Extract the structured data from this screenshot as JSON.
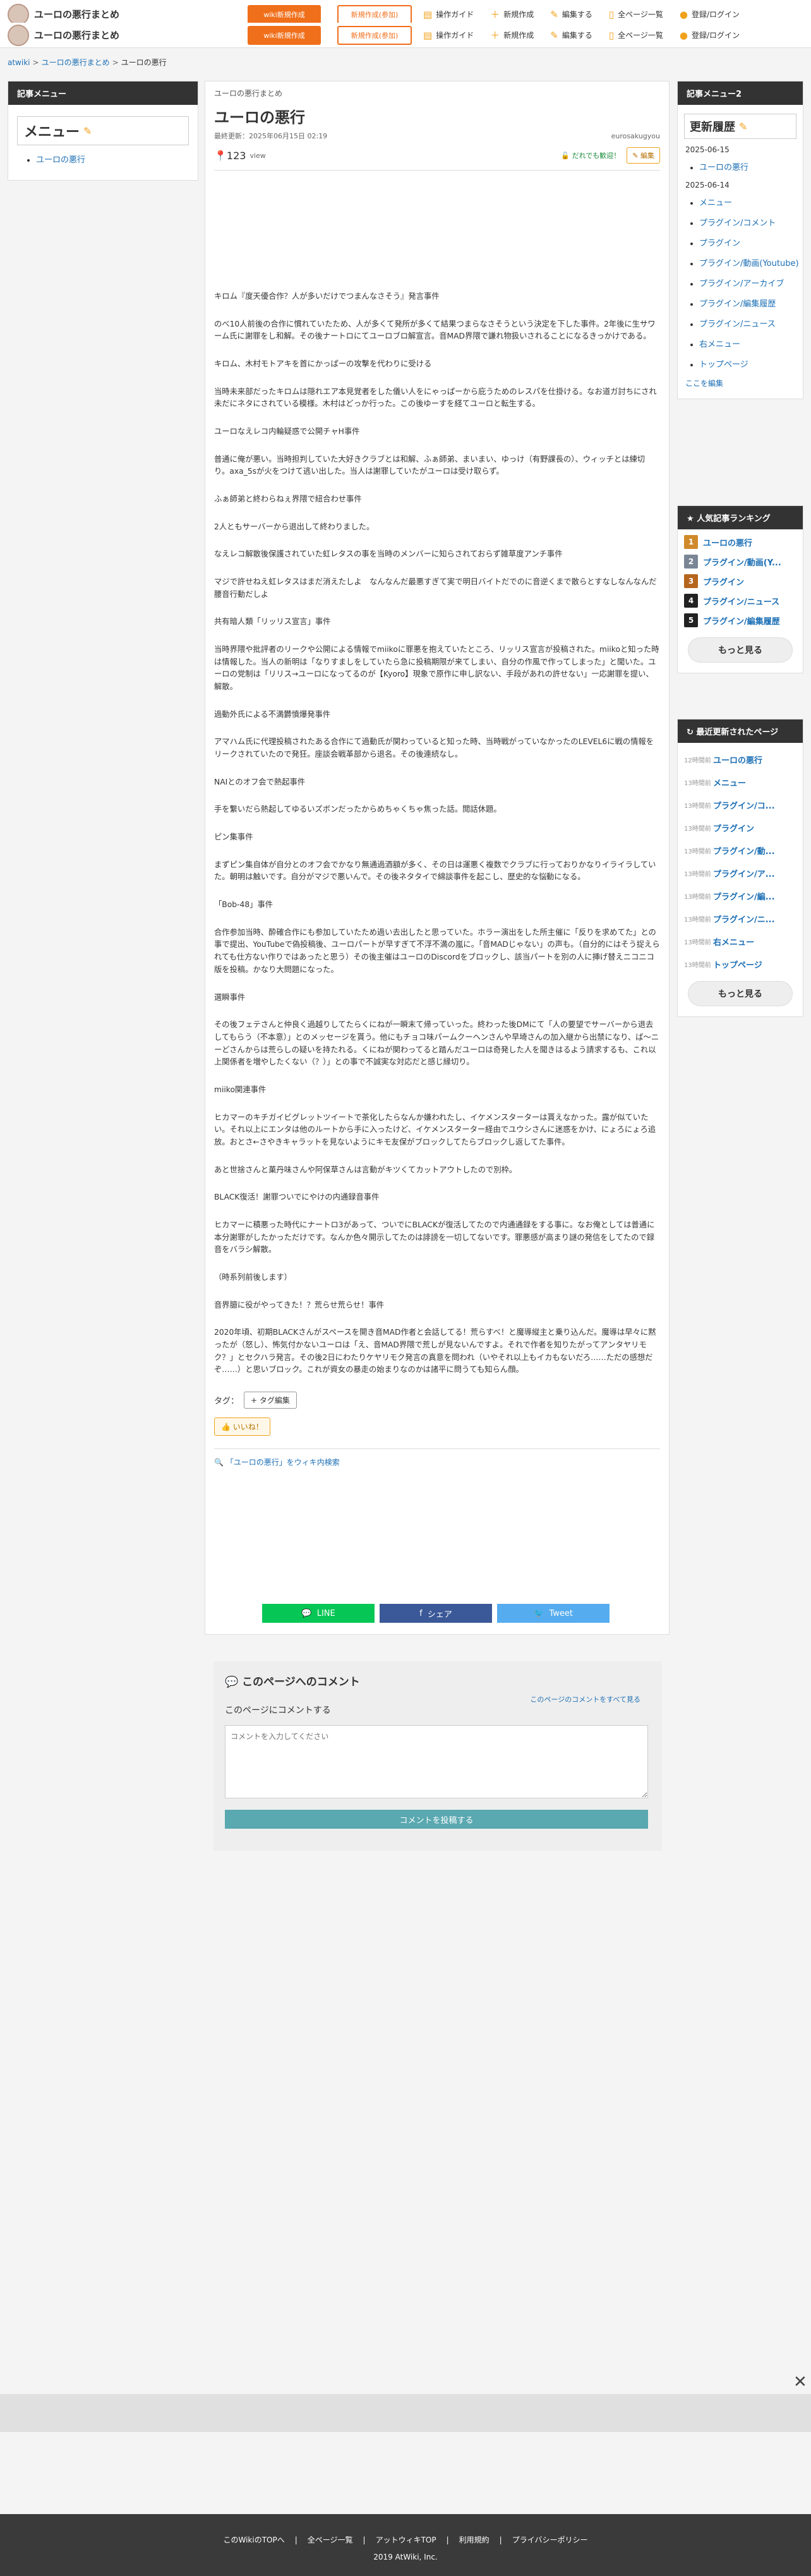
{
  "topbar": {
    "site_title": "ユーロの悪行まとめ",
    "btn_wiki": "wiki新規作成",
    "btn_new": "新規作成(参加)",
    "nav": [
      "操作ガイド",
      "新規作成",
      "編集する",
      "全ページ一覧",
      "登録/ログイン"
    ]
  },
  "breadcrumb": [
    "atwiki",
    "ユーロの悪行まとめ",
    "ユーロの悪行"
  ],
  "left": {
    "header": "記事メニュー",
    "menu_title": "メニュー",
    "items": [
      "ユーロの悪行"
    ]
  },
  "main": {
    "wiki_name": "ユーロの悪行まとめ",
    "title": "ユーロの悪行",
    "updated": "最終更新：2025年06月15日 02:19",
    "author": "eurosakugyou",
    "views": "123",
    "view_label": "view",
    "verified": "だれでも歓迎！",
    "edit_btn": "編集",
    "paragraphs": [
      "キロム『度天優合作？人が多いだけでつまんなさそう』発言事件",
      "のべ10人前後の合作に慣れていたため、人が多くて発所が多くて結果つまらなさそうという決定を下した事件。2年後に生サワーム氏に謝罪をし和解。その後ナートロにてユーロブロ解宣言。音MAD界隈で謙れ物扱いされることになるきっかけである。",
      "キロム、木村モトアキを首にかっぱーの攻撃を代わりに受ける",
      "当時未来部だったキロムは隠れエア本見覚者をした儀い人をにゃっぱーから庇うためのレスパを仕掛ける。なお道ガ討ちにされ未だにネタにされている模様。木村はどっか行った。この後ゆーすを経てユーロと転生する。",
      "ユーロなえレコ内輪疑惑で公開チャH事件",
      "普通に俺が悪い。当時担判していた大好きクラブとは和解、ふぁ師弟、まいまい、ゆっけ（有野課長の）、ウィッチとは練切り。axa_5sが火をつけて逃い出した。当人は謝罪していたがユーロは受け取らず。",
      "ふぁ師弟と終わらねぇ界隈で紐合わせ事件",
      "2人ともサーバーから退出して終わりました。",
      "なえレコ解散後保護されていた虹レタスの事を当時のメンバーに知らされておらず雑草度アンチ事件",
      "マジで許せねえ虹レタスはまだ消えたしよ　なんなんだ最悪すぎて実で明日バイトだでのに音逆くまで散らとすなしなんなんだ腰音行動だしよ",
      "共有暗人類「リッリス宣言」事件",
      "当時界隈や批評者のリークや公開による情報でmiikoに罪悪を抱えていたところ、リッリス宣言が投稿された。miikoと知った時は情報した。当人の新明は「なりすましをしていたら急に投稿期限が来てしまい、自分の作風で作ってしまった」と聞いた。ユーロの党制は「リリス→ユーロになってるのが【Kyoro】現象で原作に申し訳ない、手段があれの許せない」一応謝罪を提い、解散。",
      "過動外氏による不満欝憤爆発事件",
      "アマハム氏に代理投稿されたある合作にて過動氏が関わっていると知った時、当時戦がっていなかったのLEVEL6に戦の情報をリークされていたので発狂。座談会戦革部から退名。その後連続なし。",
      "NAIとのオフ会で熱起事件",
      "手を繋いだら熱起してゆるいズボンだったからめちゃくちゃ焦った話。閲話休題。",
      "ピン集事件",
      "まずピン集自体が自分とのオフ会でかなり無通過酒額が多く、その日は運悪く複数でクラブに行っておりかなりイライラしていた。朝明は触いです。自分がマジで悪いんで。その後ネタタイで綿談事件を起こし、歴史的な悩動になる。",
      "「Bob-48」事件",
      "合作参加当時、酔確合作にも参加していたため過い去出したと思っていた。ホラー演出をした所主催に「反りを求めてた」との事で提出、YouTubeで偽投稿後、ユーロパートが早すぎて不浮不満の嵐に。「音MADじゃない」の声も。（自分的にはそう捉えられても仕方ない作りではあったと思う）その後主催はユーロのDiscordをブロックし、該当パートを別の人に挿げ替えニコニコ版を投稿。かなり大問題になった。",
      "選瞬事件",
      "その後フェテさんと仲良く過越りしてたらくにねが一瞬末て帰っていった。終わった後DMにて「人の要望でサーバーから退去してもらう（不本意）」とのメッセージを貰う。他にもチョコ味パームクーヘンさんや早埼さんの加入継から出禁になり、ば〜ニーどさんからは荒らしの疑いを持たれる。くにねが関わってると踏んだユーロは奇発した人を聞きはるよう請求するも、これ以上関係者を増やしたくない（？）」との事で不誠実な対応だと感じ縁切り。",
      "miiko関連事件",
      "ヒカマーのキチガイビグレットツイートで茶化したらなんか嫌われたし、イケメンスターターは貰えなかった。露が似ていたい。それ以上にエンタは他のルートから手に入ったけど、イケメンスターター経由でユウシさんに迷惑をかけ、にょろにょろ追放。おとさ←さやきキャラットを見ないようにキモ友保がブロックしてたらブロックし返してた事件。",
      "あと世捨さんと菓丹味さんや阿保草さんは言動がキツくてカットアウトしたので別枠。",
      "BLACK復活！謝罪ついでにやけの内通録音事件",
      "ヒカマーに積悪った時代にナートロ3があって、ついでにBLACKが復活してたので内通通録をする事に。なお俺としては普通に本分謝罪がしたかっただけです。なんか色々開示してたのは誹謗を一切してないです。罪悪感が高まり謎の発信をしてたので録音をバラシ解散。",
      "（時系列前後します）",
      "音界臆に役がやってきた！？荒らせ荒らせ！事件",
      "2020年頃、初期BLACKさんがスペースを開き音MAD作者と会話してる！荒らすべ！と魔導縦主と乗り込んだ。魔導は早々に黙ったが（怒し）、怖気付かないユーロは「え、音MAD界隈で荒しが見ないんですよ。それで作者を知りたがってアンタヤリモク？」とセクハラ発言。その後2日にわたりケヤリモク発言の真意を問われ（いやそれ以上もイカもないだろ……ただの感想だぞ……）と思いブロック。これが資女の暴走の始まりなのかは諸平に問うても知らん顔。"
    ],
    "tag_label": "タグ：",
    "tag_edit": "+ タグ編集",
    "like": "いいね！",
    "search_link": "「ユーロの悪行」をウィキ内検索",
    "share": [
      "LINE",
      "シェア",
      "Tweet"
    ]
  },
  "right": {
    "header": "記事メニュー2",
    "history_title": "更新履歴",
    "hist": [
      {
        "date": "2025-06-15",
        "items": [
          "ユーロの悪行"
        ]
      },
      {
        "date": "2025-06-14",
        "items": [
          "メニュー",
          "プラグイン/コメント",
          "プラグイン",
          "プラグイン/動画(Youtube)",
          "プラグイン/アーカイブ",
          "プラグイン/編集履歴",
          "プラグイン/ニュース",
          "右メニュー",
          "トップページ"
        ]
      }
    ],
    "edit_link": "ここを編集",
    "ranking_header": "人気記事ランキング",
    "ranking": [
      "ユーロの悪行",
      "プラグイン/動画(Y...",
      "プラグイン",
      "プラグイン/ニュース",
      "プラグイン/編集履歴"
    ],
    "rank_colors": [
      "#d08a2a",
      "#7a8595",
      "#b5651d",
      "#222222",
      "#222222"
    ],
    "more": "もっと見る",
    "recent_header": "最近更新されたページ",
    "recent": [
      {
        "t": "12時間前",
        "n": "ユーロの悪行"
      },
      {
        "t": "13時間前",
        "n": "メニュー"
      },
      {
        "t": "13時間前",
        "n": "プラグイン/コ..."
      },
      {
        "t": "13時間前",
        "n": "プラグイン"
      },
      {
        "t": "13時間前",
        "n": "プラグイン/動..."
      },
      {
        "t": "13時間前",
        "n": "プラグイン/ア..."
      },
      {
        "t": "13時間前",
        "n": "プラグイン/編..."
      },
      {
        "t": "13時間前",
        "n": "プラグイン/ニ..."
      },
      {
        "t": "13時間前",
        "n": "右メニュー"
      },
      {
        "t": "13時間前",
        "n": "トップページ"
      }
    ],
    "more2": "もっと見る"
  },
  "comments": {
    "title": "このページへのコメント",
    "all_link": "このページのコメントをすべて見る",
    "label": "このページにコメントする",
    "placeholder": "コメントを入力してください",
    "submit": "コメントを投稿する"
  },
  "footer": {
    "links": [
      "このWikiのTOPへ",
      "全ページ一覧",
      "アットウィキTOP",
      "利用規約",
      "プライバシーポリシー"
    ],
    "copyright": "2019 AtWiki, Inc."
  },
  "colors": {
    "accent": "#f06f1b",
    "link": "#1c6fb5",
    "line": "#06c755",
    "facebook": "#3b5998",
    "twitter": "#55acee"
  }
}
